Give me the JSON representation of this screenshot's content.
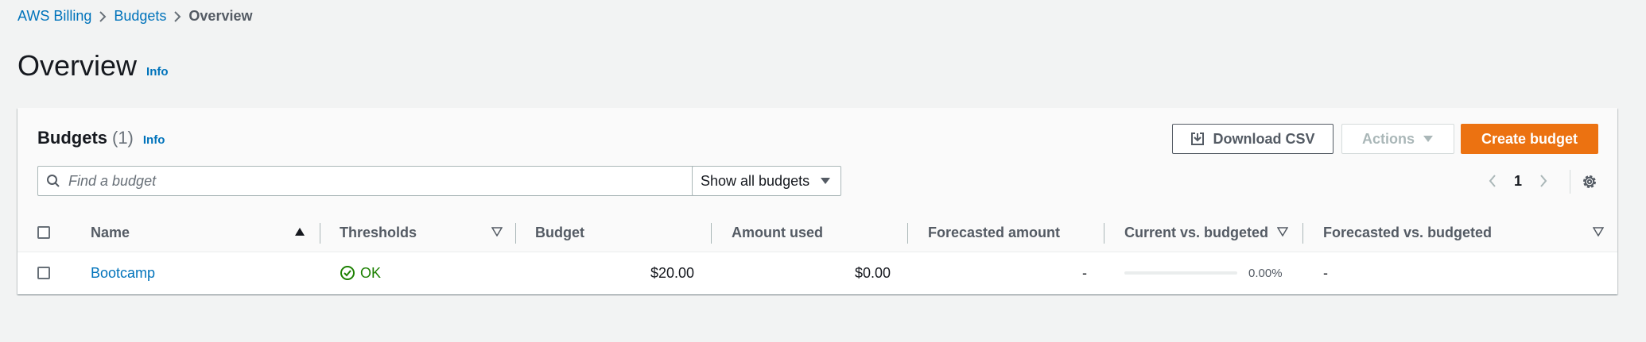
{
  "breadcrumb": {
    "items": [
      "AWS Billing",
      "Budgets"
    ],
    "current": "Overview"
  },
  "page": {
    "title": "Overview",
    "info": "Info"
  },
  "panel": {
    "title": "Budgets",
    "count": "(1)",
    "info": "Info",
    "buttons": {
      "download": "Download CSV",
      "actions": "Actions",
      "create": "Create budget"
    },
    "search": {
      "placeholder": "Find a budget",
      "value": ""
    },
    "filter": {
      "selected": "Show all budgets"
    },
    "pagination": {
      "current_page": "1"
    }
  },
  "table": {
    "columns": [
      "Name",
      "Thresholds",
      "Budget",
      "Amount used",
      "Forecasted amount",
      "Current vs. budgeted",
      "Forecasted vs. budgeted"
    ],
    "rows": [
      {
        "name": "Bootcamp",
        "threshold": "OK",
        "budget": "$20.00",
        "amount_used": "$0.00",
        "forecasted_amount": "-",
        "current_vs_budgeted": "0.00%",
        "current_vs_budgeted_fraction": 0,
        "forecasted_vs_budgeted": "-"
      }
    ]
  },
  "colors": {
    "link": "#0073bb",
    "primary": "#ec7211",
    "success": "#1d8102"
  }
}
